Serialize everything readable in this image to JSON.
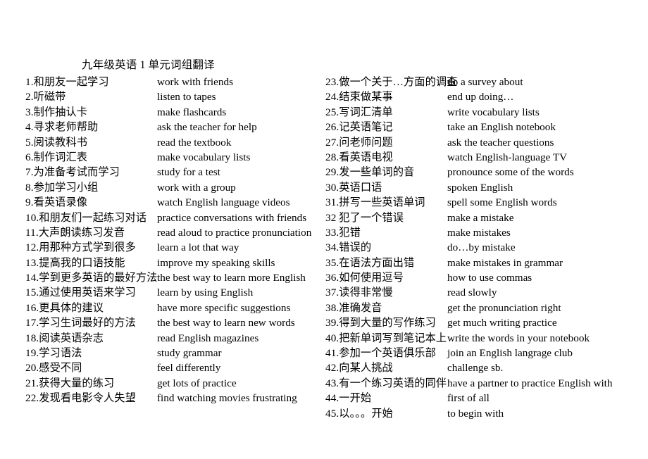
{
  "document": {
    "title": "九年级英语 1 单元词组翻译",
    "page_background": "#ffffff",
    "text_color": "#000000"
  },
  "columns": {
    "left": {
      "items": [
        {
          "num": "1.",
          "cn": "和朋友一起学习",
          "en": "work with friends"
        },
        {
          "num": "2.",
          "cn": "听磁带",
          "en": "listen to tapes"
        },
        {
          "num": "3.",
          "cn": "制作抽认卡",
          "en": "make flashcards"
        },
        {
          "num": "4.",
          "cn": "寻求老师帮助",
          "en": "ask the teacher for help"
        },
        {
          "num": "5.",
          "cn": "阅读教科书",
          "en": "read the textbook"
        },
        {
          "num": "6.",
          "cn": "制作词汇表",
          "en": "make vocabulary lists"
        },
        {
          "num": "7.",
          "cn": "为准备考试而学习",
          "en": "study for a test"
        },
        {
          "num": "8.",
          "cn": "参加学习小组",
          "en": "work with a group"
        },
        {
          "num": "9.",
          "cn": "看英语录像",
          "en": "watch English language videos"
        },
        {
          "num": "10.",
          "cn": "和朋友们一起练习对话",
          "en": "practice conversations with friends"
        },
        {
          "num": "11.",
          "cn": "大声朗读练习发音",
          "en": "read aloud to practice pronunciation"
        },
        {
          "num": "12.",
          "cn": "用那种方式学到很多",
          "en": "learn a lot that way"
        },
        {
          "num": "13.",
          "cn": "提高我的口语技能",
          "en": "improve my speaking skills"
        },
        {
          "num": "14.",
          "cn": "学到更多英语的最好方法",
          "en": "the best way to learn more English"
        },
        {
          "num": "15.",
          "cn": "通过使用英语来学习",
          "en": "learn by using English"
        },
        {
          "num": "16.",
          "cn": "更具体的建议",
          "en": "have more specific suggestions"
        },
        {
          "num": "17.",
          "cn": "学习生词最好的方法",
          "en": "the best way to learn new words"
        },
        {
          "num": "18.",
          "cn": "阅读英语杂志",
          "en": "read English magazines"
        },
        {
          "num": "19.",
          "cn": "学习语法",
          "en": "study grammar"
        },
        {
          "num": "20.",
          "cn": "感受不同",
          "en": "feel differently"
        },
        {
          "num": "21.",
          "cn": "获得大量的练习",
          "en": "get lots of practice"
        },
        {
          "num": "22.",
          "cn": "发现看电影令人失望",
          "en": "find watching movies frustrating"
        }
      ]
    },
    "right": {
      "items": [
        {
          "num": "23.",
          "cn": "做一个关于…方面的调查",
          "en": "do a survey about"
        },
        {
          "num": "24.",
          "cn": "结束做某事",
          "en": "end up doing…"
        },
        {
          "num": "25.",
          "cn": "写词汇清单",
          "en": "write vocabulary lists"
        },
        {
          "num": "26.",
          "cn": "记英语笔记",
          "en": "take an English notebook"
        },
        {
          "num": "27.",
          "cn": "问老师问题",
          "en": "ask the teacher questions"
        },
        {
          "num": "28.",
          "cn": "看英语电视",
          "en": "watch English-language TV"
        },
        {
          "num": "29.",
          "cn": "发一些单词的音",
          "en": "pronounce some of the words"
        },
        {
          "num": "30.",
          "cn": "英语口语",
          "en": "spoken English"
        },
        {
          "num": "31.",
          "cn": "拼写一些英语单词",
          "en": "spell some English words"
        },
        {
          "num": "32 ",
          "cn": "犯了一个错误",
          "en": "make a mistake"
        },
        {
          "num": "33.",
          "cn": "犯错",
          "en": "make mistakes"
        },
        {
          "num": "34.",
          "cn": "错误的",
          "en": "do…by mistake"
        },
        {
          "num": "35.",
          "cn": "在语法方面出错",
          "en": "make mistakes in grammar"
        },
        {
          "num": "36.",
          "cn": "如何使用逗号",
          "en": "how to use commas"
        },
        {
          "num": "37.",
          "cn": "读得非常慢",
          "en": "read slowly"
        },
        {
          "num": "38.",
          "cn": "准确发音",
          "en": "get the pronunciation right"
        },
        {
          "num": "39.",
          "cn": "得到大量的写作练习",
          "en": "get much writing practice"
        },
        {
          "num": "40.",
          "cn": "把新单词写到笔记本上",
          "en": "write the words in your notebook"
        },
        {
          "num": "41.",
          "cn": "参加一个英语俱乐部",
          "en": "join an English langrage club"
        },
        {
          "num": "42.",
          "cn": "向某人挑战",
          "en": "challenge sb."
        },
        {
          "num": "43.",
          "cn": "有一个练习英语的同伴",
          "en": "have a partner to practice English with"
        },
        {
          "num": "44.",
          "cn": "一开始",
          "en": "first of all"
        },
        {
          "num": "45.",
          "cn": "以。。。开始",
          "en": "to begin with"
        }
      ]
    }
  }
}
